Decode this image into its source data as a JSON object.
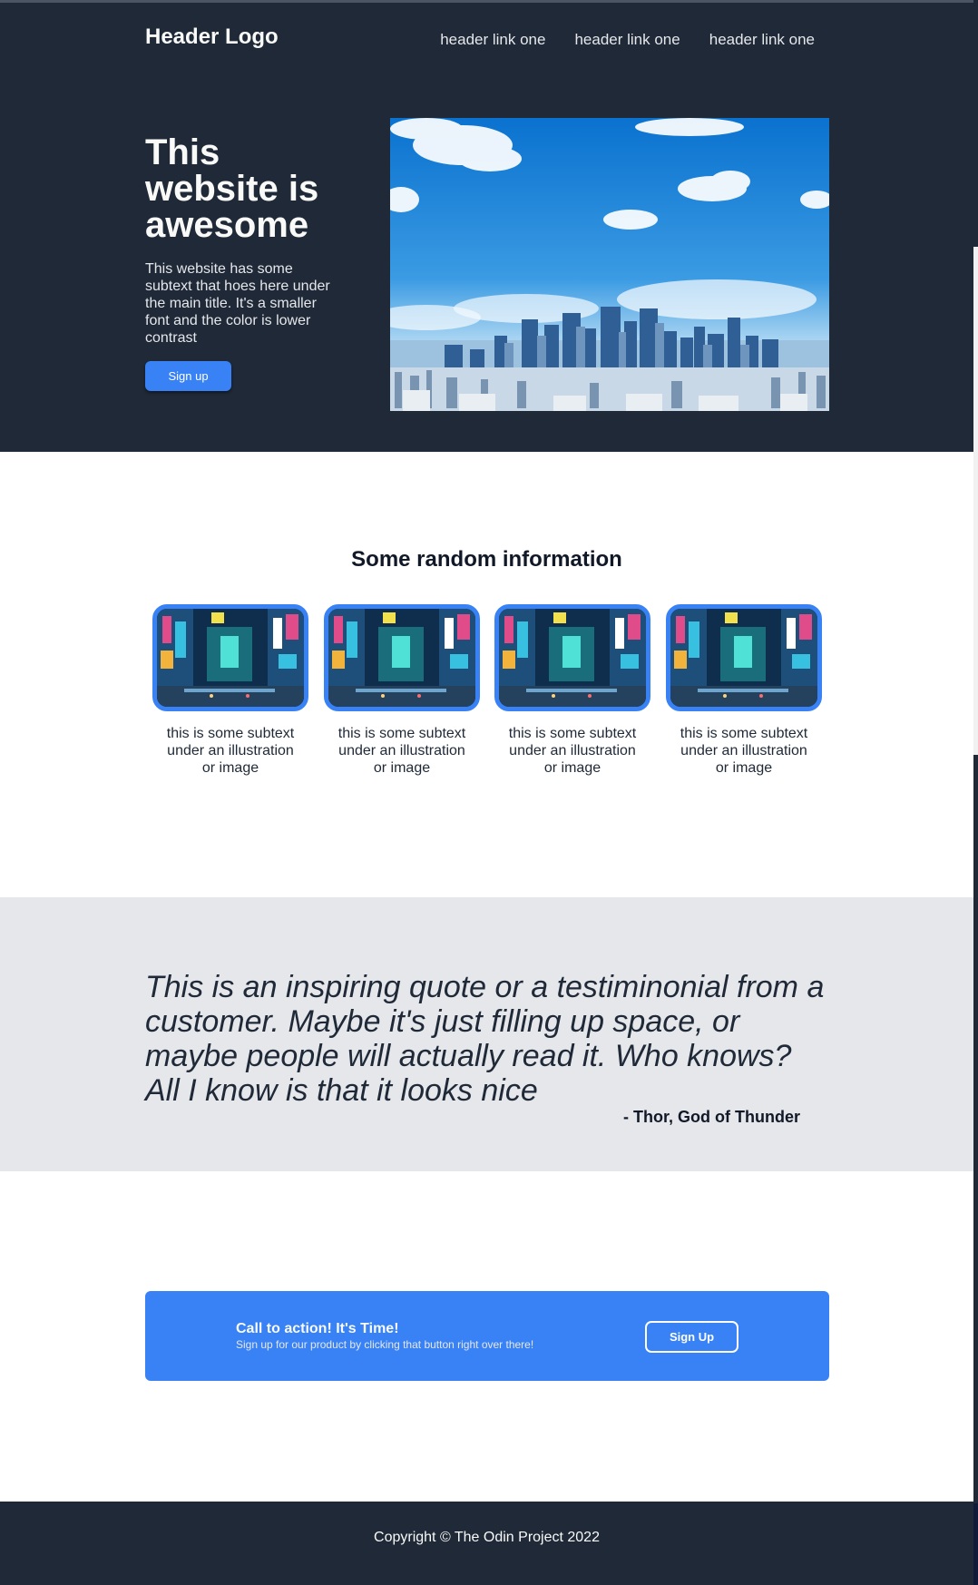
{
  "header": {
    "logo": "Header Logo",
    "nav_links": [
      "header link one",
      "header link one",
      "header link one"
    ]
  },
  "hero": {
    "title": "This website is awesome",
    "subtext": "This website has some subtext that hoes here under the main title. It's a smaller font and the color is lower contrast",
    "button_label": "Sign up",
    "image_icon": "city-skyline-image"
  },
  "info": {
    "title": "Some random information",
    "cards": [
      {
        "caption": "this is some subtext under an illustration or image"
      },
      {
        "caption": "this is some subtext under an illustration or image"
      },
      {
        "caption": "this is some subtext under an illustration or image"
      },
      {
        "caption": "this is some subtext under an illustration or image"
      }
    ],
    "card_image_icon": "city-street-night-image"
  },
  "quote": {
    "text": "This is an inspiring quote or a testiminonial from a customer. Maybe it's just filling up space, or maybe people will actually read it. Who knows? All I know is that it looks nice",
    "author": "- Thor, God of Thunder"
  },
  "cta": {
    "title": "Call to action! It's Time!",
    "subtext": "Sign up for our product by clicking that button right over there!",
    "button_label": "Sign Up"
  },
  "footer": {
    "copyright": "Copyright © The Odin Project 2022"
  },
  "colors": {
    "dark": "#1f2937",
    "accent": "#3882f6",
    "light_gray": "#e5e7eb",
    "white": "#f9faf8"
  }
}
